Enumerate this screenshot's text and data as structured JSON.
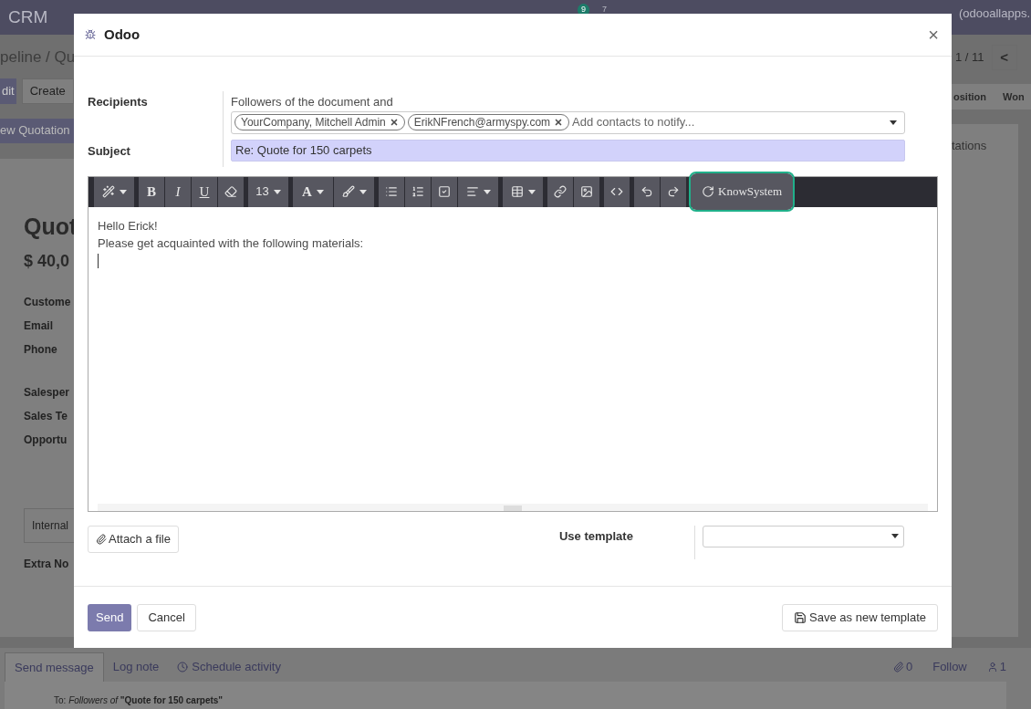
{
  "navbar": {
    "app": "CRM",
    "activity_count": "9",
    "message_count": "7",
    "user": "(odooallapps."
  },
  "background": {
    "breadcrumb": "peline / Qu",
    "buttons": [
      "dit",
      "Create"
    ],
    "new_quotation": "ew Quotation",
    "pager": "1 / 11",
    "pager_prev": "<",
    "stages": [
      "osition",
      "Won"
    ],
    "sheet_tab": "tations",
    "title": "Quot",
    "amount": "$ 40,0",
    "fields": [
      "Custome",
      "Email",
      "Phone",
      "Salesper",
      "Sales Te",
      "Opportu"
    ],
    "notebook_tab": "Internal",
    "extra": "Extra No"
  },
  "dialog": {
    "title": "Odoo",
    "close": "×",
    "recipients": {
      "label": "Recipients",
      "note": "Followers of the document and",
      "tags": [
        {
          "label": "YourCompany, Mitchell Admin"
        },
        {
          "label": "ErikNFrench@armyspy.com"
        }
      ],
      "placeholder": "Add contacts to notify..."
    },
    "subject": {
      "label": "Subject",
      "value": "Re: Quote for 150 carpets"
    },
    "toolbar": [
      [
        {
          "kind": "magic",
          "caret": true
        }
      ],
      [
        {
          "kind": "bold",
          "label": "B",
          "caret": false
        },
        {
          "kind": "italic",
          "label": "I",
          "caret": false
        },
        {
          "kind": "underline",
          "label": "U",
          "caret": false
        },
        {
          "kind": "eraser",
          "caret": false
        }
      ],
      [
        {
          "kind": "size",
          "label": "13",
          "caret": true
        }
      ],
      [
        {
          "kind": "color",
          "label": "A",
          "caret": true
        },
        {
          "kind": "brush",
          "caret": true
        }
      ],
      [
        {
          "kind": "bullets",
          "caret": false
        },
        {
          "kind": "numbers",
          "caret": false
        },
        {
          "kind": "checklist",
          "caret": false
        },
        {
          "kind": "align",
          "caret": true
        }
      ],
      [
        {
          "kind": "table",
          "caret": true
        }
      ],
      [
        {
          "kind": "link",
          "caret": false
        },
        {
          "kind": "image",
          "caret": false
        }
      ],
      [
        {
          "kind": "code",
          "caret": false
        }
      ],
      [
        {
          "kind": "undo",
          "caret": false
        },
        {
          "kind": "redo",
          "caret": false
        }
      ],
      [
        {
          "kind": "plugin",
          "label": "KnowSystem",
          "highlighted": true
        }
      ]
    ],
    "body": [
      "Hello Erick!",
      "Please get acquainted with the following materials:"
    ],
    "attach": "Attach a file",
    "template_label": "Use template",
    "send": "Send",
    "cancel": "Cancel",
    "save_template": "Save as new template"
  },
  "chatter": {
    "tabs": [
      {
        "label": "Send message",
        "selected": true
      },
      {
        "label": "Log note",
        "selected": false
      },
      {
        "label": "Schedule activity",
        "selected": false
      }
    ],
    "attachments": "0",
    "follow": "Follow",
    "followers": "1",
    "to": "To: *Followers of* **\"Quote for 150 carpets\"**"
  }
}
